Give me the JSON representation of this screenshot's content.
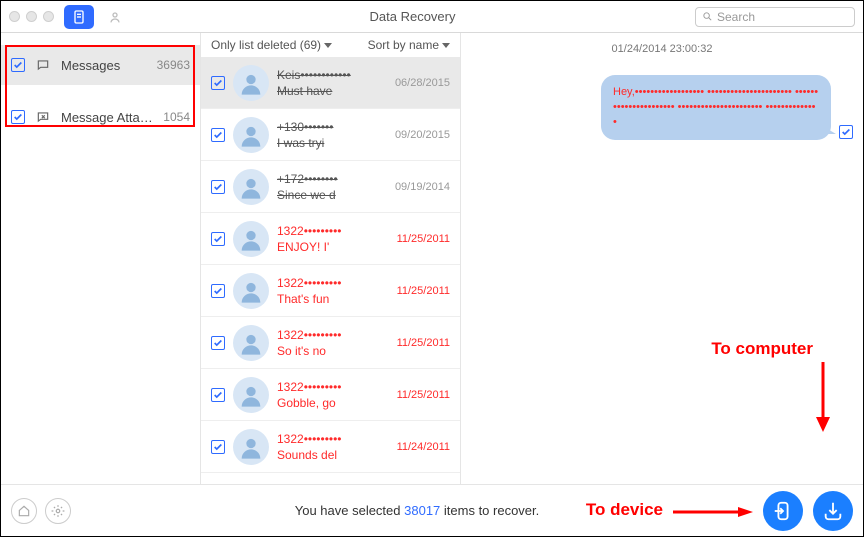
{
  "titlebar": {
    "title": "Data Recovery",
    "search_placeholder": "Search"
  },
  "sidebar": {
    "items": [
      {
        "label": "Messages",
        "count": "36963"
      },
      {
        "label": "Message Attac…",
        "count": "1054"
      }
    ]
  },
  "filter": {
    "left": "Only list deleted (69)",
    "right": "Sort by name"
  },
  "conversations": [
    {
      "name": "Keis••••••••••••",
      "preview": "Must have",
      "date": "06/28/2015",
      "kind": "strike",
      "selected": true
    },
    {
      "name": "+130•••••••",
      "preview": "I was tryi",
      "date": "09/20/2015",
      "kind": "strike"
    },
    {
      "name": "+172••••••••",
      "preview": "Since we d",
      "date": "09/19/2014",
      "kind": "strike"
    },
    {
      "name": "1322•••••••••",
      "preview": "ENJOY!  I'",
      "date": "11/25/2011",
      "kind": "deleted"
    },
    {
      "name": "1322•••••••••",
      "preview": "That's fun",
      "date": "11/25/2011",
      "kind": "deleted"
    },
    {
      "name": "1322•••••••••",
      "preview": "So it's no",
      "date": "11/25/2011",
      "kind": "deleted"
    },
    {
      "name": "1322•••••••••",
      "preview": "Gobble, go",
      "date": "11/25/2011",
      "kind": "deleted"
    },
    {
      "name": "1322•••••••••",
      "preview": "Sounds del",
      "date": "11/24/2011",
      "kind": "deleted"
    }
  ],
  "preview": {
    "timestamp": "01/24/2014 23:00:32",
    "bubble": "Hey,•••••••••••••••••• •••••••••••••••••••••• •••••••••••••••••••••• •••••••••••••••••••••• ••••••••••••••"
  },
  "footer": {
    "text_pre": "You have selected ",
    "count": "38017",
    "text_post": " items to recover."
  },
  "annotations": {
    "to_computer": "To computer",
    "to_device": "To device"
  }
}
